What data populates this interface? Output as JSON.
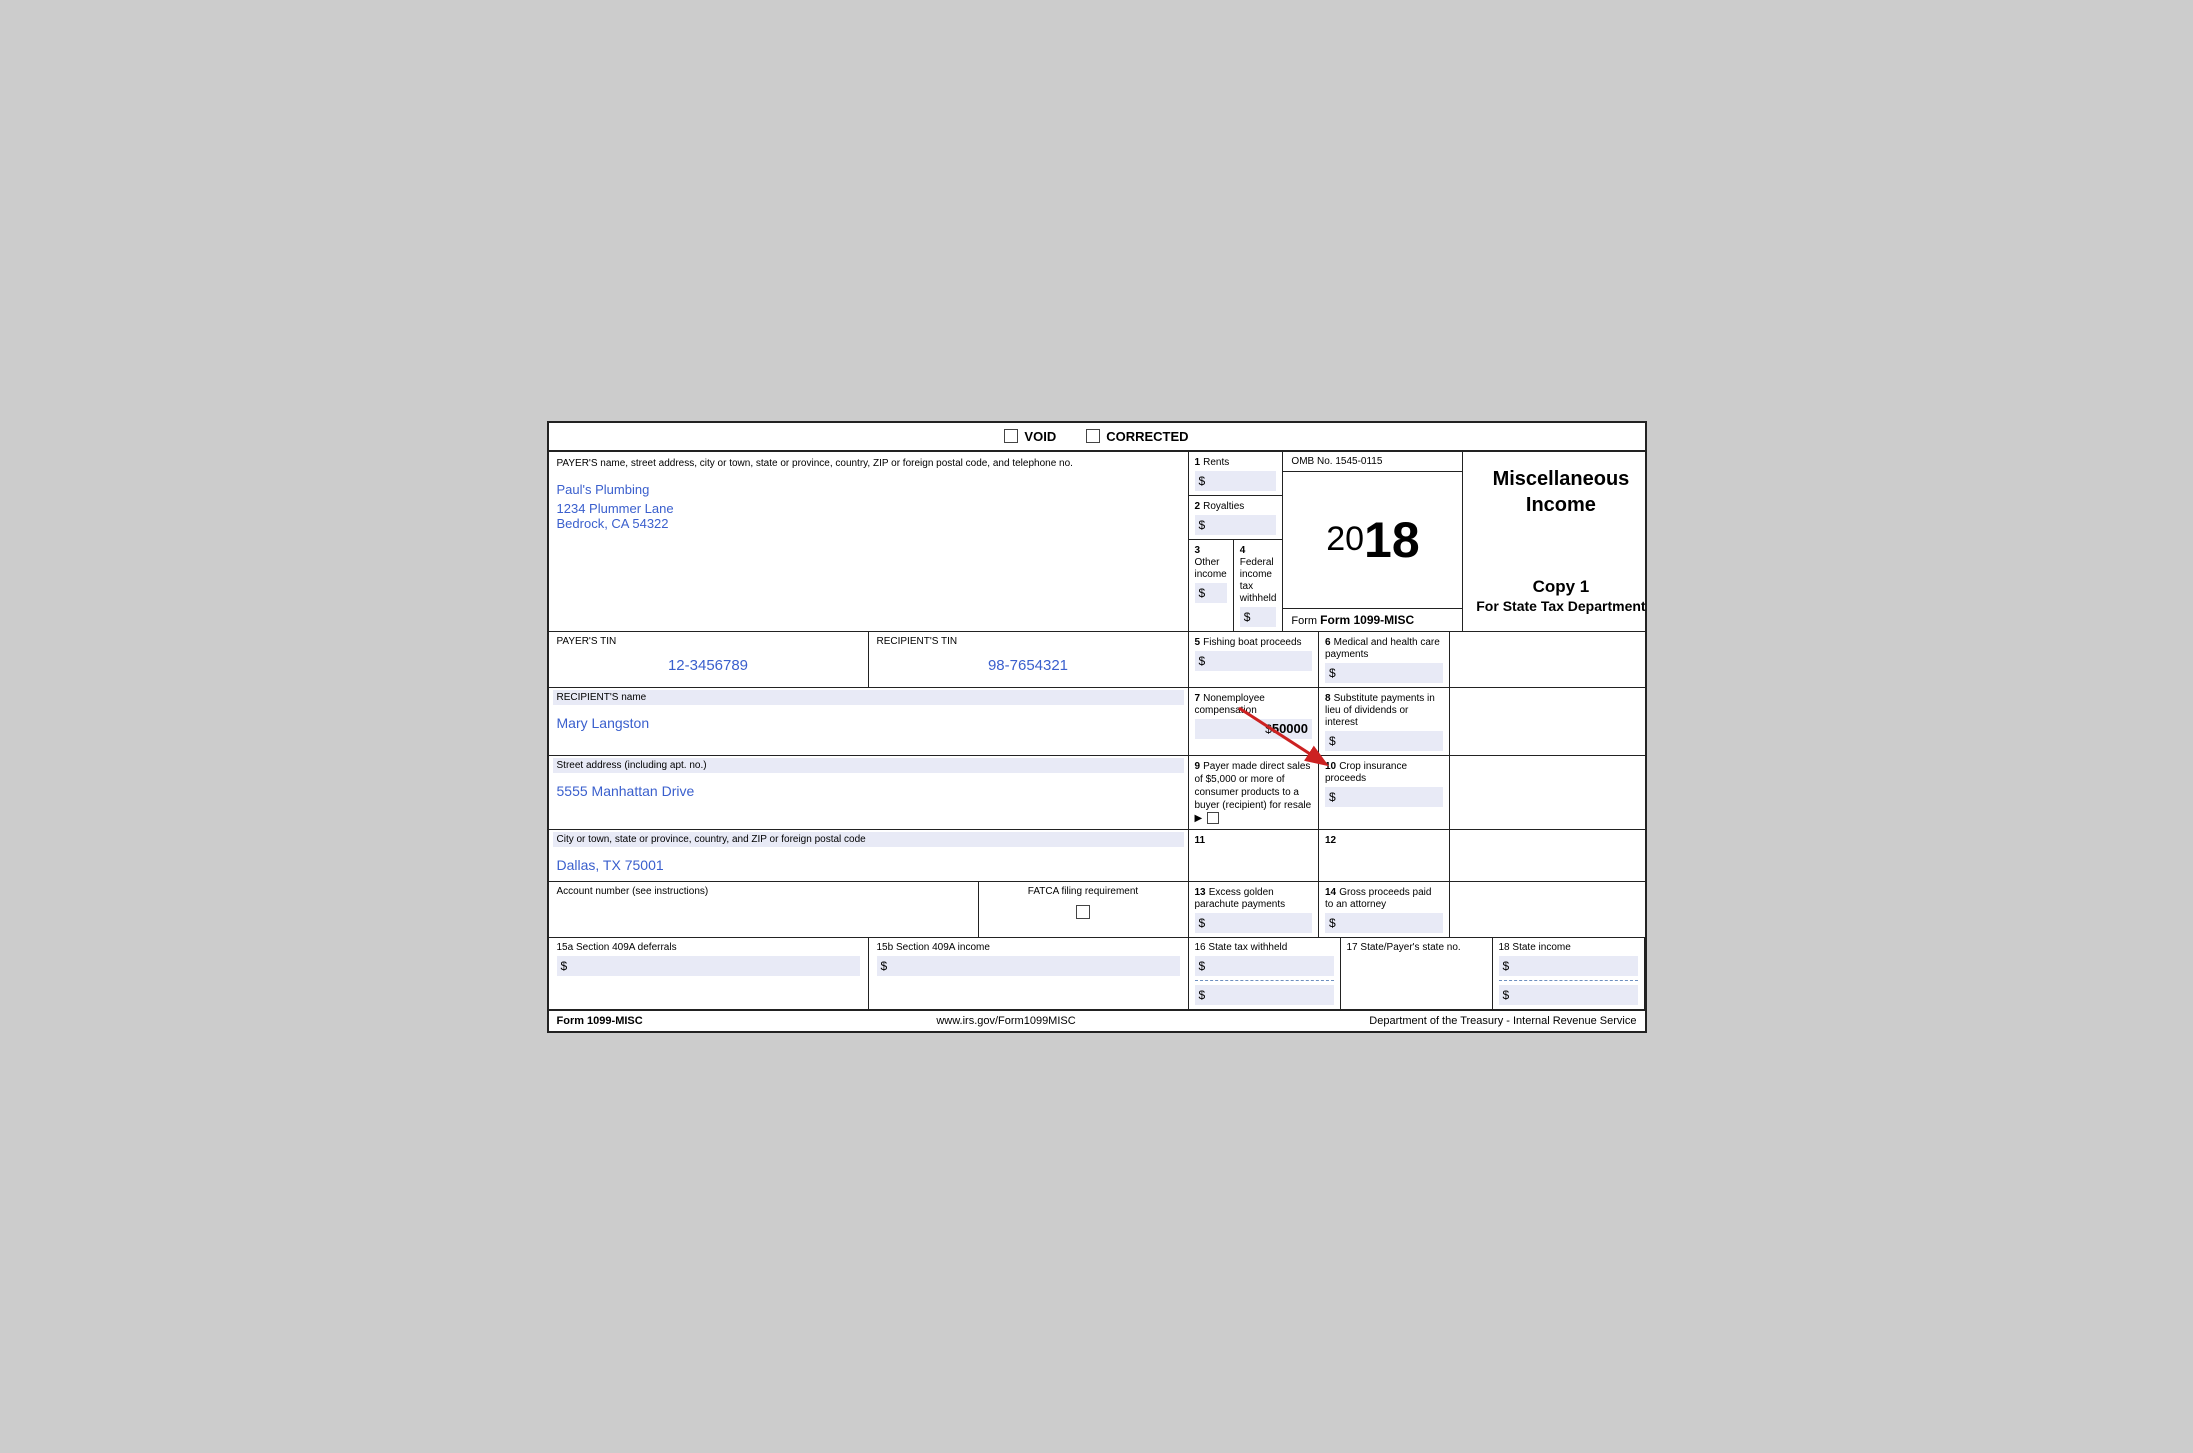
{
  "header": {
    "void_label": "VOID",
    "corrected_label": "CORRECTED"
  },
  "payer": {
    "field_label": "PAYER'S name, street address, city or town, state or province, country, ZIP or foreign postal code, and telephone no.",
    "name": "Paul's Plumbing",
    "address": "1234 Plummer Lane",
    "city_state_zip": "Bedrock, CA 54322"
  },
  "omb": {
    "label": "OMB No. 1545-0115",
    "year": "2018",
    "year_prefix": "20",
    "year_suffix": "18",
    "form_name": "Form 1099-MISC"
  },
  "title": {
    "main": "Miscellaneous Income",
    "copy": "Copy 1",
    "subtitle": "For State Tax Department"
  },
  "fields": {
    "rents": {
      "num": "1",
      "label": "Rents",
      "value": "$"
    },
    "royalties": {
      "num": "2",
      "label": "Royalties",
      "value": "$"
    },
    "other_income": {
      "num": "3",
      "label": "Other income",
      "value": "$"
    },
    "federal_tax": {
      "num": "4",
      "label": "Federal income tax withheld",
      "value": "$"
    },
    "fishing": {
      "num": "5",
      "label": "Fishing boat proceeds",
      "value": "$"
    },
    "medical": {
      "num": "6",
      "label": "Medical and health care payments",
      "value": "$"
    },
    "nonemployee": {
      "num": "7",
      "label": "Nonemployee compensation",
      "value": "50000"
    },
    "substitute": {
      "num": "8",
      "label": "Substitute payments in lieu of dividends or interest",
      "value": "$"
    },
    "direct_sales": {
      "num": "9",
      "label": "Payer made direct sales of $5,000 or more of consumer products to a buyer (recipient) for resale ▶"
    },
    "crop": {
      "num": "10",
      "label": "Crop insurance proceeds",
      "value": "$"
    },
    "field11": {
      "num": "11",
      "label": ""
    },
    "field12": {
      "num": "12",
      "label": ""
    },
    "excess_golden": {
      "num": "13",
      "label": "Excess golden parachute payments",
      "value": "$"
    },
    "gross_proceeds": {
      "num": "14",
      "label": "Gross proceeds paid to an attorney",
      "value": "$"
    }
  },
  "tin": {
    "payer_label": "PAYER'S TIN",
    "payer_value": "12-3456789",
    "recipient_label": "RECIPIENT'S TIN",
    "recipient_value": "98-7654321"
  },
  "recipient": {
    "name_label": "RECIPIENT'S name",
    "name_value": "Mary Langston",
    "street_label": "Street address (including apt. no.)",
    "street_value": "5555 Manhattan Drive",
    "city_label": "City or town, state or province, country, and ZIP or foreign postal code",
    "city_value": "Dallas, TX 75001"
  },
  "account": {
    "label": "Account number (see instructions)",
    "fatca_label": "FATCA filing requirement",
    "section15a_label": "15a Section 409A deferrals",
    "section15a_value": "$",
    "section15b_label": "15b Section 409A income",
    "section15b_value": "$"
  },
  "state": {
    "tax_label": "16 State tax withheld",
    "tax_value1": "$",
    "tax_value2": "$",
    "payer_state_label": "17 State/Payer's state no.",
    "income_label": "18 State income",
    "income_value1": "$",
    "income_value2": "$"
  },
  "footer": {
    "form_name": "Form 1099-MISC",
    "website": "www.irs.gov/Form1099MISC",
    "dept": "Department of the Treasury - Internal Revenue Service"
  }
}
